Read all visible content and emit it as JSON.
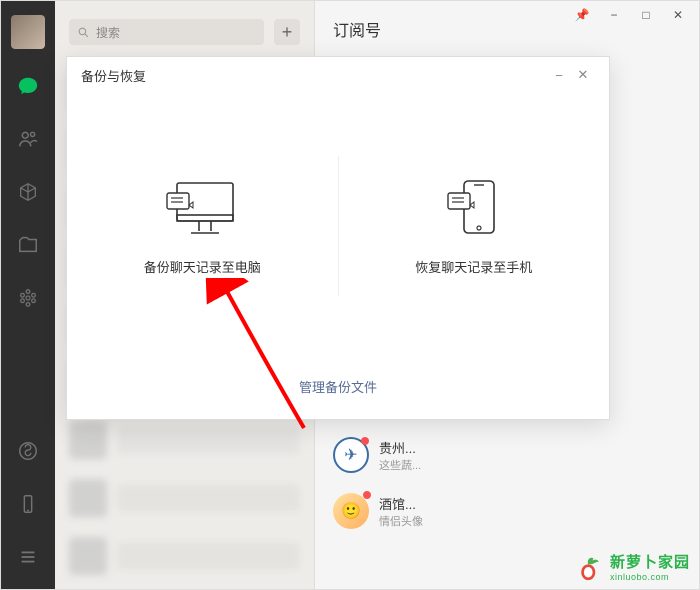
{
  "window": {
    "title": "订阅号",
    "pin": "📌",
    "min": "−",
    "max": "□",
    "close": "✕"
  },
  "search": {
    "placeholder": "搜索"
  },
  "modal": {
    "title": "备份与恢复",
    "backup_label": "备份聊天记录至电脑",
    "restore_label": "恢复聊天记录至手机",
    "manage": "管理备份文件",
    "min": "−",
    "close": "✕"
  },
  "conversations": [
    {
      "name": "贵州...",
      "sub": "这些蔬..."
    },
    {
      "name": "酒馆...",
      "sub": "情侣头像"
    }
  ],
  "watermark": {
    "name": "新萝卜家园",
    "domain": "xinluobo.com"
  }
}
